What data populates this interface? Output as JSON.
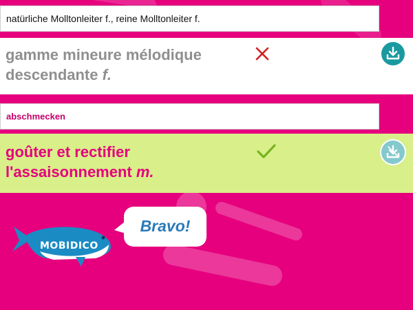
{
  "cards": [
    {
      "prompt": "natürliche Molltonleiter f., reine Molltonleiter f.",
      "answer_line1": "gamme mineure mélodique",
      "answer_line2": "descendante ",
      "answer_gender": "f.",
      "result": "wrong",
      "button_icon": "download-icon"
    },
    {
      "prompt": "abschmecken",
      "answer_line1": "goûter et rectifier",
      "answer_line2": "l'assaisonnement ",
      "answer_gender": "m.",
      "result": "correct",
      "button_icon": "download-icon"
    }
  ],
  "mascot": {
    "name": "MOBIDICO",
    "speech": "Bravo!"
  },
  "colors": {
    "background": "#e6007e",
    "answer_wrong_bg": "#ffffff",
    "answer_correct_bg": "#d8ef8a",
    "wrong_mark": "#d32020",
    "correct_mark": "#78b41e",
    "button_teal": "#1a9aa0",
    "button_teal_light": "#84c9cd",
    "speech_text": "#2a7ab8"
  }
}
